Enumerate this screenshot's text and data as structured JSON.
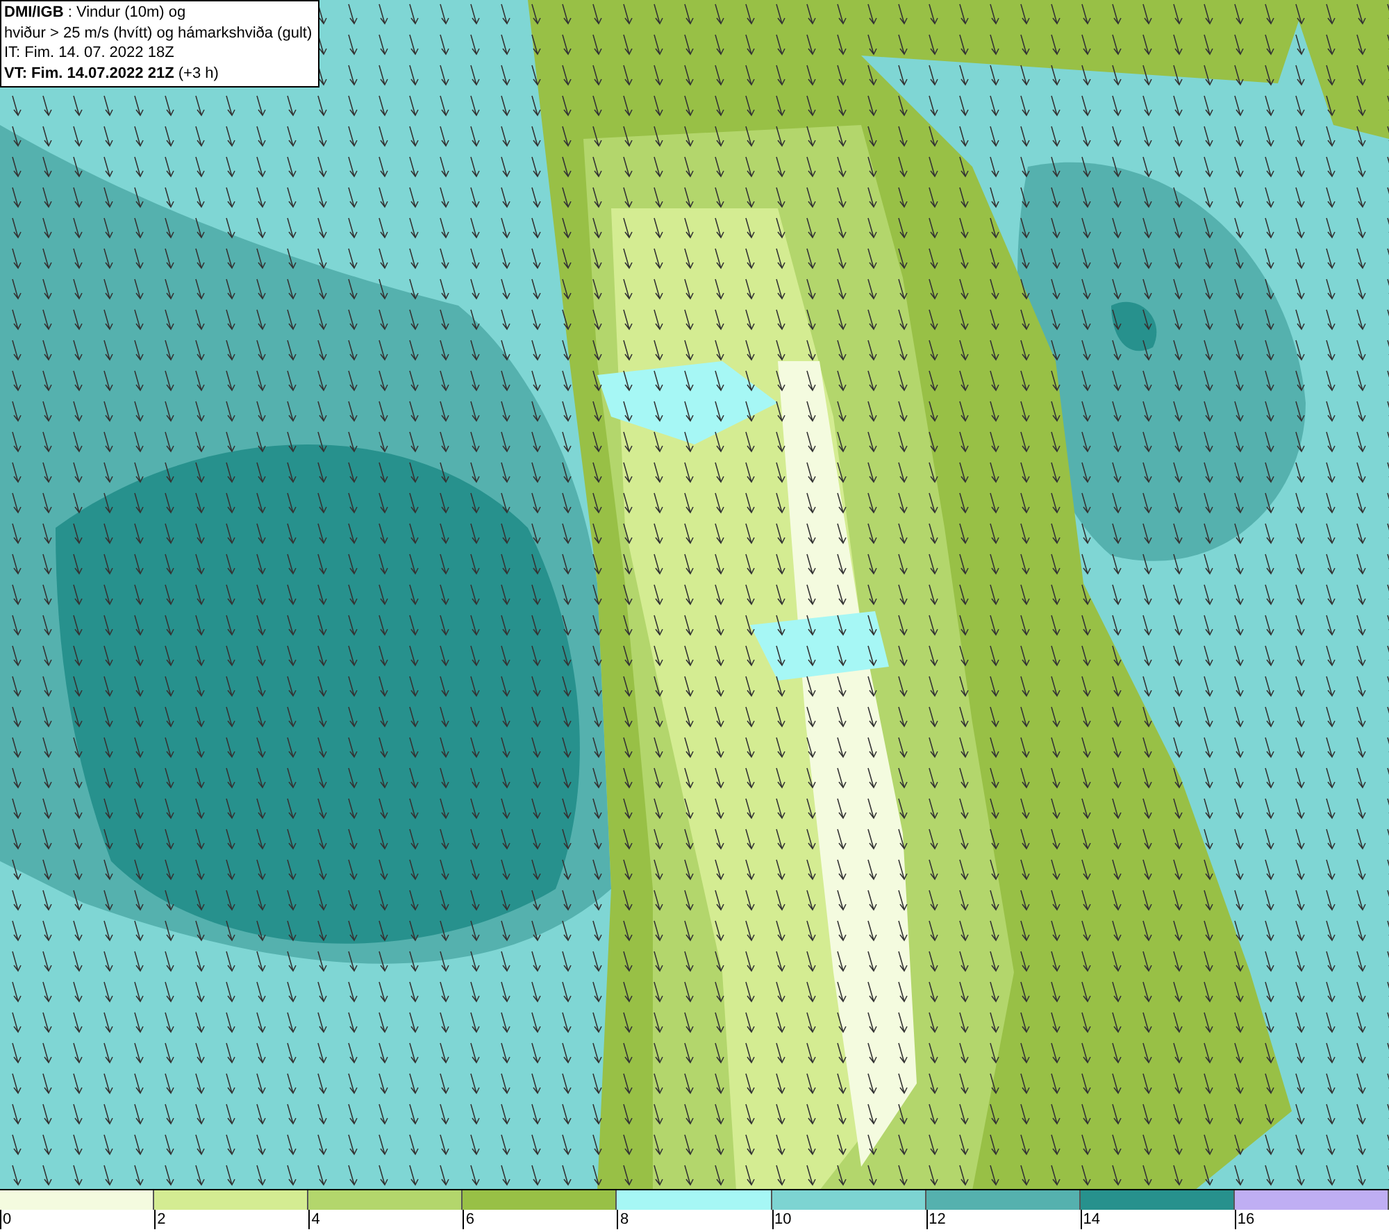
{
  "info_box": {
    "lines": [
      "**DMI/IGB** : Vindur (10m) og",
      "hviður > 25 m/s (hvítt) og hámarkshviða (gult)",
      "IT: Fim. 14. 07. 2022 18Z",
      "**VT: Fim. 14.07.2022 21Z** (+3 h)"
    ]
  },
  "legend": {
    "bins": [
      {
        "label": "0",
        "color": "#f4fbdf"
      },
      {
        "label": "2",
        "color": "#d4ec92"
      },
      {
        "label": "4",
        "color": "#b3d66c"
      },
      {
        "label": "6",
        "color": "#98c046"
      },
      {
        "label": "8",
        "color": "#a6f7f5"
      },
      {
        "label": "10",
        "color": "#7dd4d2"
      },
      {
        "label": "12",
        "color": "#55b1ae"
      },
      {
        "label": "14",
        "color": "#27918d"
      },
      {
        "label": "16",
        "color": "#bfaef3"
      }
    ]
  }
}
